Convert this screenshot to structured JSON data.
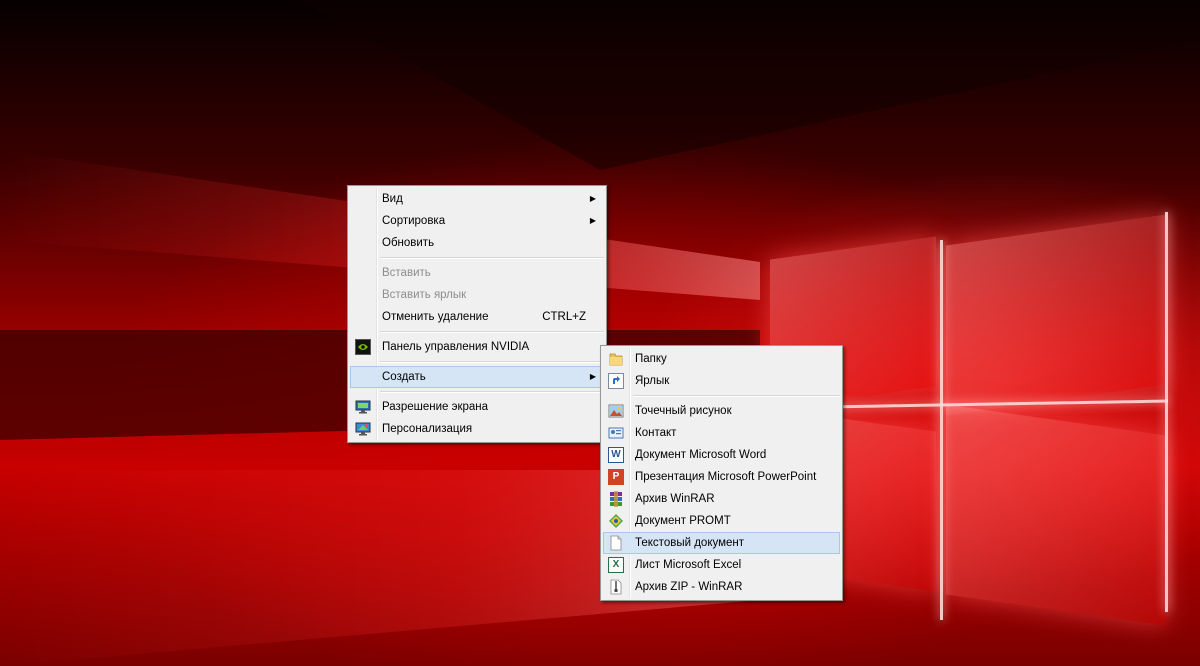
{
  "main_menu": {
    "items": [
      {
        "label": "Вид",
        "arrow": "▶"
      },
      {
        "label": "Сортировка",
        "arrow": "▶"
      },
      {
        "label": "Обновить"
      },
      {
        "label": "Вставить"
      },
      {
        "label": "Вставить ярлык"
      },
      {
        "label": "Отменить удаление",
        "shortcut": "CTRL+Z"
      },
      {
        "label": "Панель управления NVIDIA",
        "icon": "nvidia-icon"
      },
      {
        "label": "Создать",
        "arrow": "▶"
      },
      {
        "label": "Разрешение экрана",
        "icon": "display-icon"
      },
      {
        "label": "Персонализация",
        "icon": "personalization-icon"
      }
    ]
  },
  "submenu": {
    "items": [
      {
        "label": "Папку",
        "icon": "folder-icon"
      },
      {
        "label": "Ярлык",
        "icon": "shortcut-icon"
      },
      {
        "label": "Точечный рисунок",
        "icon": "bitmap-icon"
      },
      {
        "label": "Контакт",
        "icon": "contact-icon"
      },
      {
        "label": "Документ Microsoft Word",
        "icon": "word-icon"
      },
      {
        "label": "Презентация Microsoft PowerPoint",
        "icon": "powerpoint-icon"
      },
      {
        "label": "Архив WinRAR",
        "icon": "winrar-icon"
      },
      {
        "label": "Документ PROMT",
        "icon": "promt-icon"
      },
      {
        "label": "Текстовый документ",
        "icon": "text-document-icon"
      },
      {
        "label": "Лист Microsoft Excel",
        "icon": "excel-icon"
      },
      {
        "label": "Архив ZIP - WinRAR",
        "icon": "zip-icon"
      }
    ]
  },
  "icon_glyphs": {
    "word": "W",
    "powerpoint": "P",
    "excel": "X"
  },
  "colors": {
    "menu_bg": "#f0f0f0",
    "highlight_bg": "#d5e5f6",
    "highlight_border": "#aac6e8",
    "disabled_text": "#8d8d8d",
    "wallpaper_red": "#c80000"
  }
}
